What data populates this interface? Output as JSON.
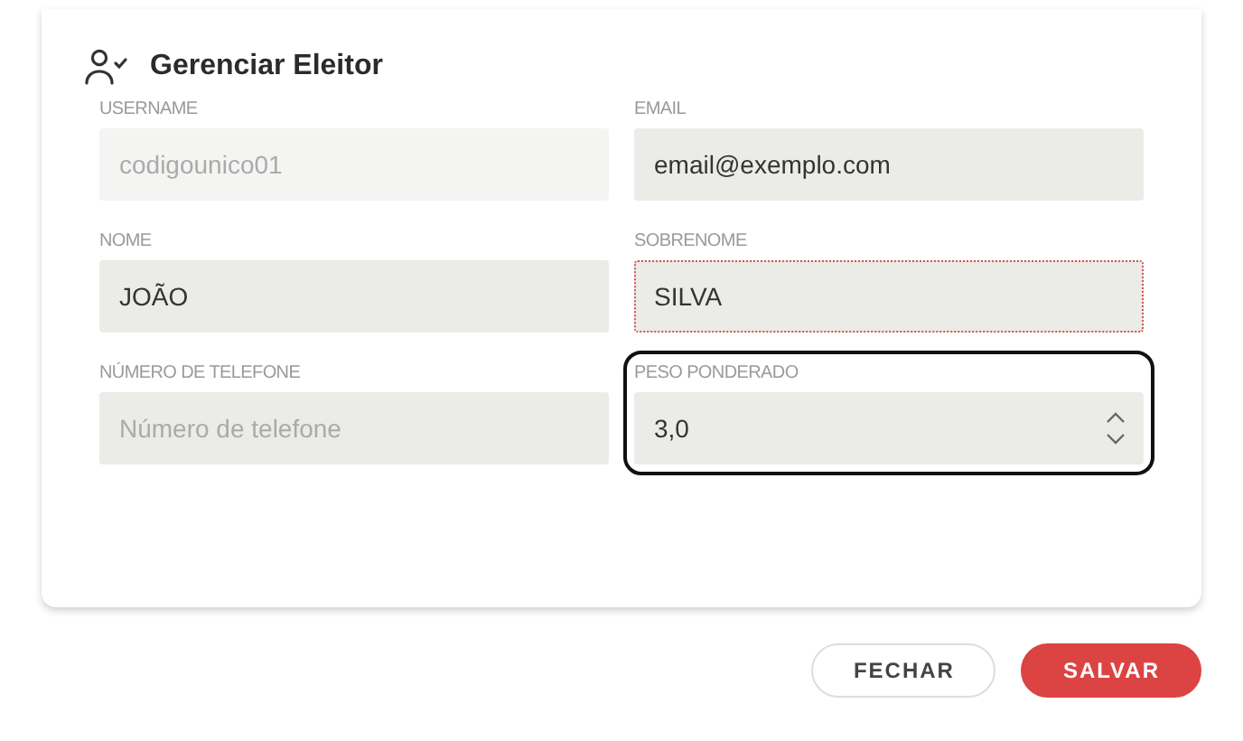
{
  "dialog": {
    "title": "Gerenciar Eleitor",
    "fields": [
      {
        "label": "USERNAME",
        "kind": "text",
        "value": "codigounico01",
        "disabled": true,
        "invalid": false,
        "focused": false
      },
      {
        "label": "EMAIL",
        "kind": "text",
        "value": "email@exemplo.com",
        "disabled": false,
        "invalid": false,
        "focused": false
      },
      {
        "label": "NOME",
        "kind": "text",
        "value": "JOÃO",
        "disabled": false,
        "invalid": false,
        "focused": false
      },
      {
        "label": "SOBRENOME",
        "kind": "text",
        "value": "SILVA",
        "disabled": false,
        "invalid": true,
        "focused": false
      },
      {
        "label": "NÚMERO DE TELEFONE",
        "kind": "text",
        "placeholder": "Número de telefone",
        "disabled": false,
        "invalid": false,
        "focused": false
      },
      {
        "label": "PESO PONDERADO",
        "kind": "number",
        "value": "3,0",
        "disabled": false,
        "invalid": false,
        "focused": true
      }
    ]
  },
  "buttons": [
    {
      "label": "FECHAR",
      "kind": "secondary"
    },
    {
      "label": "SALVAR",
      "kind": "primary"
    }
  ]
}
